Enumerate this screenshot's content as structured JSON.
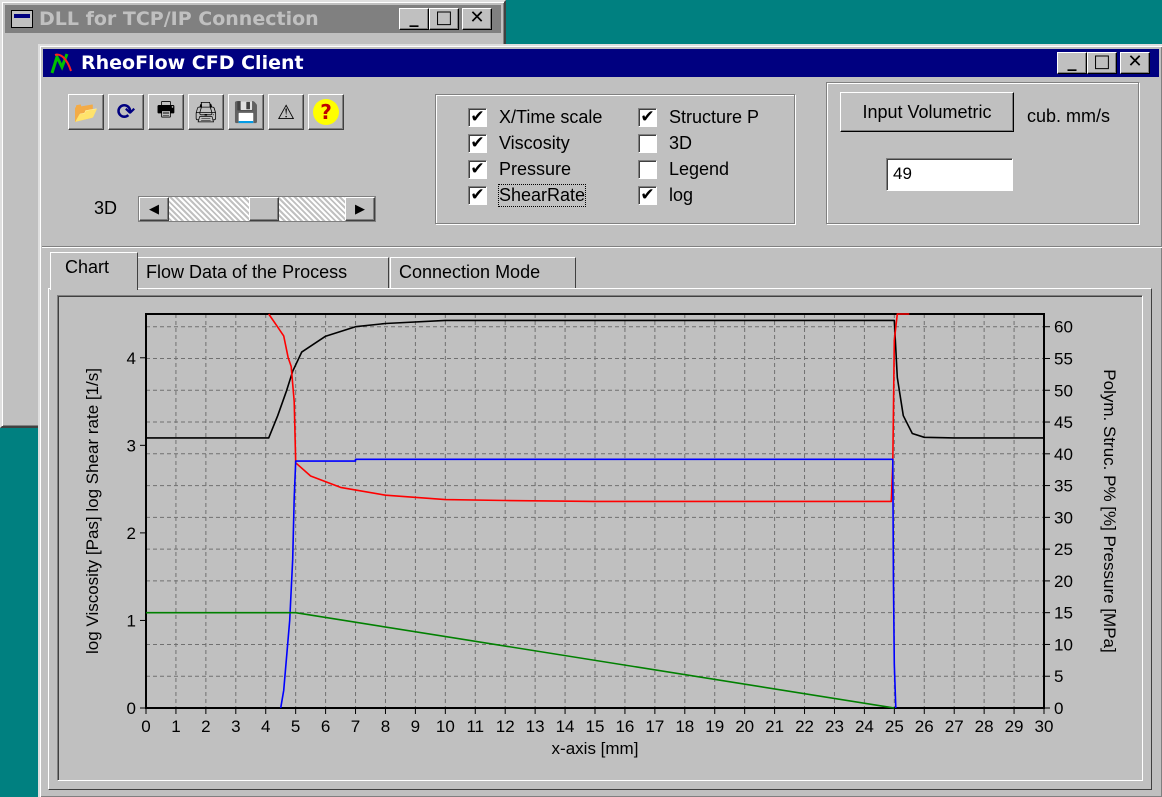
{
  "bg_window": {
    "title": "DLL for TCP/IP Connection"
  },
  "main_window": {
    "title": "RheoFlow CFD Client"
  },
  "caption_buttons": {
    "minimize": "_",
    "maximize": "□",
    "close": "✕"
  },
  "toolbar": {
    "buttons": [
      {
        "icon": "folder-open-icon",
        "glyph": "📂"
      },
      {
        "icon": "refresh-icon",
        "glyph": "⟳"
      },
      {
        "icon": "printer-icon",
        "glyph": "🖶"
      },
      {
        "icon": "print-setup-icon",
        "glyph": "🖨"
      },
      {
        "icon": "save-icon",
        "glyph": "💾"
      },
      {
        "icon": "warning-icon",
        "glyph": "⚠"
      },
      {
        "icon": "help-icon",
        "glyph": "?"
      }
    ]
  },
  "slider": {
    "label": "3D",
    "left_arrow": "◀",
    "right_arrow": "▶",
    "value": 0.55
  },
  "options": {
    "items": [
      {
        "label": "X/Time scale",
        "checked": true
      },
      {
        "label": "Viscosity",
        "checked": true
      },
      {
        "label": "Pressure",
        "checked": true
      },
      {
        "label": "ShearRate",
        "checked": true
      },
      {
        "label": "Structure P",
        "checked": true
      },
      {
        "label": "3D",
        "checked": false
      },
      {
        "label": "Legend",
        "checked": false
      },
      {
        "label": "log",
        "checked": true
      }
    ],
    "check_glyph": "✔"
  },
  "volumetric": {
    "button_label": "Input Volumetric",
    "unit": "cub. mm/s",
    "value": "49"
  },
  "tabs": [
    {
      "label": "Chart",
      "selected": true
    },
    {
      "label": "Flow Data of the Process",
      "selected": false
    },
    {
      "label": "Connection Mode",
      "selected": false
    }
  ],
  "colors": {
    "desktop": "#008080",
    "face": "#c0c0c0",
    "active_title": "#000080",
    "inactive_title": "#808080",
    "viscosity": "#ff0000",
    "shear_rate": "#0000ff",
    "pressure": "#008000",
    "structure": "#000000"
  },
  "chart_data": {
    "type": "line",
    "xlabel": "x-axis [mm]",
    "ylabel": "log Viscosity [Pas]  log Shear rate [1/s]",
    "y2label": "Polym. Struc. P% [%]  Pressure [MPa]",
    "xlim": [
      0,
      30
    ],
    "ylim": [
      0,
      4.5
    ],
    "y2lim": [
      0,
      62
    ],
    "x_ticks": [
      0,
      1,
      2,
      3,
      4,
      5,
      6,
      7,
      8,
      9,
      10,
      11,
      12,
      13,
      14,
      15,
      16,
      17,
      18,
      19,
      20,
      21,
      22,
      23,
      24,
      25,
      26,
      27,
      28,
      29,
      30
    ],
    "y_ticks": [
      0,
      1,
      2,
      3,
      4
    ],
    "y2_ticks": [
      0,
      5,
      10,
      15,
      20,
      25,
      30,
      35,
      40,
      45,
      50,
      55,
      60
    ],
    "grid": true,
    "series": [
      {
        "key": "structure",
        "axis": "y2",
        "color": "#000000",
        "x": [
          0,
          4.1,
          4.4,
          4.7,
          4.9,
          5.2,
          6,
          7,
          8,
          10,
          25.0,
          25.1,
          25.3,
          25.6,
          26,
          27,
          30
        ],
        "y": [
          42.5,
          42.5,
          46,
          50,
          53,
          56,
          58.5,
          60,
          60.5,
          61,
          61,
          52,
          46,
          43.2,
          42.6,
          42.5,
          42.5
        ]
      },
      {
        "key": "viscosity",
        "axis": "y",
        "color": "#ff0000",
        "x": [
          4.1,
          4.4,
          4.6,
          4.75,
          4.85,
          4.95,
          5.0,
          5.5,
          6.5,
          8,
          10,
          12,
          15,
          20,
          24.9,
          24.95,
          25.0,
          25.1,
          25.5
        ],
        "y": [
          4.5,
          4.35,
          4.25,
          4.0,
          3.9,
          3.5,
          2.8,
          2.65,
          2.52,
          2.43,
          2.38,
          2.37,
          2.36,
          2.36,
          2.36,
          2.8,
          4.2,
          4.5,
          4.5
        ]
      },
      {
        "key": "shear_rate",
        "axis": "y",
        "color": "#0000ff",
        "x": [
          4.5,
          4.6,
          4.7,
          4.8,
          4.9,
          4.95,
          5.0,
          7.0,
          7.0,
          24.95,
          24.97,
          25.0,
          25.05
        ],
        "y": [
          0,
          0.2,
          0.6,
          1.0,
          1.7,
          2.4,
          2.82,
          2.82,
          2.84,
          2.84,
          1.5,
          0.5,
          0
        ]
      },
      {
        "key": "pressure",
        "axis": "y2",
        "color": "#008000",
        "x": [
          0,
          5,
          25
        ],
        "y": [
          15,
          15,
          0
        ]
      }
    ]
  }
}
